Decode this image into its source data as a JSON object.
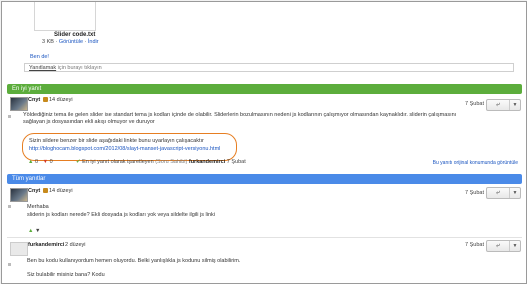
{
  "attachment": {
    "name": "Slider code.txt",
    "size": "3 KB",
    "view": "Görüntüle",
    "download": "İndir"
  },
  "top_author": "Ben de!",
  "reply_box": {
    "link": "Yanıtlamak",
    "rest": " için burayı tıklayın"
  },
  "best_answer": {
    "bar_label": "En iyi yanıt",
    "author": "Cnyt",
    "level": "14 düzeyi",
    "date": "7 Şubat",
    "text": "Yöldediğiniz tema ile gelen slider ise standart tema js kodları içinde de olabilir. Sliderlerin bozulmasının nedeni js kodlarının çalışmıyor olmasından kaynaklıdır. sliderin çalışmasını sağlayan js dosyasından ekli akışı olmuyor ve duruyor",
    "highlight_line": "Sizin sildere benzer bir slide aşağıdaki linkte bunu uyarlayın çalışacaktır",
    "highlight_link": "http://bloghocam.blogspot.com/2012/08/slayt-manset-javascript-versiyonu.html",
    "up_votes": "0",
    "down_votes": "0",
    "accepted_text": "En iyi yanıt olarak işaretleyen",
    "owner_tag": "(Soru Sahibi)",
    "accepted_by": "furkandemirci",
    "accepted_date": "7 Şubat",
    "original_link": "Bu yanıtı orijinal konumunda görüntüle"
  },
  "all_answers": {
    "bar_label": "Tüm yanıtlar",
    "posts": [
      {
        "author": "Cnyt",
        "level": "14 düzeyi",
        "date": "7 Şubat",
        "lines": [
          "Merhaba",
          "sliderin js kodları nerede? Ekli dosyada js kodları yok veya sildelte ilgili js linki"
        ]
      },
      {
        "author": "furkandemirci",
        "level": "2 düzeyi",
        "date": "7 Şubat",
        "lines": [
          "Ben bu kodu kullanıyordum hemen oluyordu. Belki yanlışlıkla js kodunu silmiş olabilirim.",
          "Siz bulabilir misiniz bana? Kodu"
        ]
      }
    ]
  },
  "icons": {
    "reply": "reply-icon",
    "dropdown": "chevron-down-icon",
    "medal": "medal-icon"
  },
  "colors": {
    "best_bar": "#5cad3c",
    "all_bar": "#4a8ae8",
    "highlight": "#e67e22",
    "link": "#1a55c0"
  }
}
